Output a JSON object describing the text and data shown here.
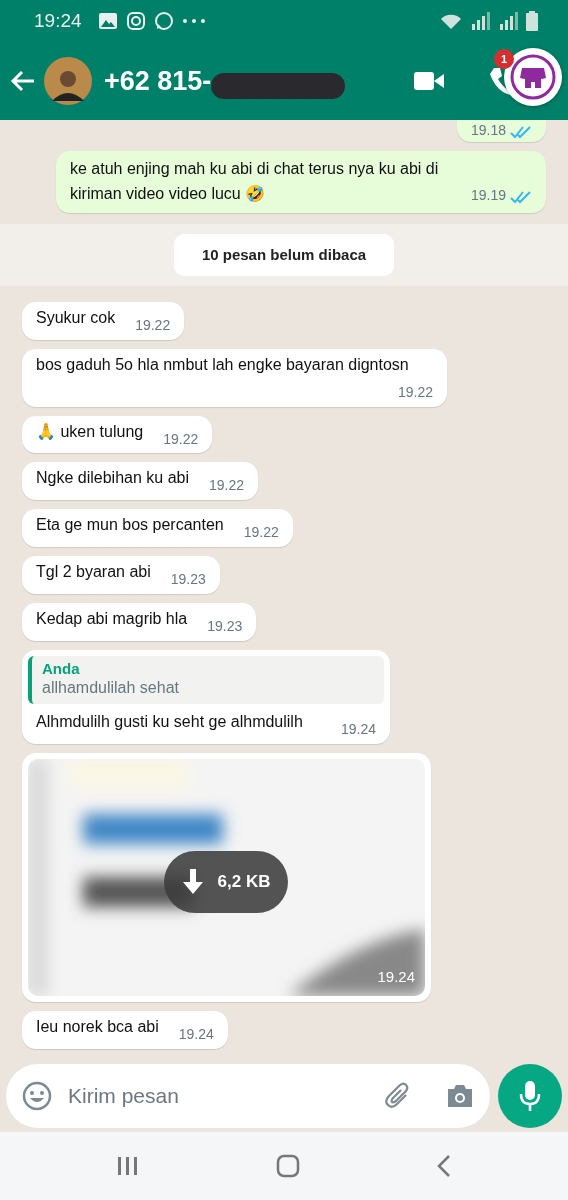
{
  "status_bar": {
    "time": "19:24"
  },
  "header": {
    "contact": "+62 815-",
    "redacted": true,
    "floating_badge": "1"
  },
  "messages": [
    {
      "kind": "out",
      "time": "19.18",
      "read": true
    },
    {
      "kind": "out",
      "text": "ke atuh enjing mah ku abi di chat terus nya ku abi di kiriman video video lucu 🤣",
      "time": "19.19",
      "read": true
    },
    {
      "kind": "divider",
      "text": "10 pesan belum dibaca"
    },
    {
      "kind": "in",
      "text": "Syukur cok",
      "time": "19.22"
    },
    {
      "kind": "in",
      "text": "bos gaduh 5o hla nmbut lah engke bayaran digntosn",
      "time": "19.22"
    },
    {
      "kind": "in",
      "text": "🙏 uken tulung",
      "time": "19.22"
    },
    {
      "kind": "in",
      "text": "Ngke dilebihan ku abi",
      "time": "19.22"
    },
    {
      "kind": "in",
      "text": "Eta ge mun bos percanten",
      "time": "19.22"
    },
    {
      "kind": "in",
      "text": "Tgl 2 byaran abi",
      "time": "19.23"
    },
    {
      "kind": "in",
      "text": "Kedap abi magrib hla",
      "time": "19.23"
    },
    {
      "kind": "quote",
      "quote_author": "Anda",
      "quote_text": "allhamdulilah sehat",
      "text": "Alhmdulilh gusti ku seht ge alhmdulilh",
      "time": "19.24"
    },
    {
      "size": "6,2 KB",
      "time": "19.24"
    },
    {
      "kind": "in",
      "text": "Ieu norek bca abi",
      "time": "19.24"
    }
  ],
  "composer": {
    "placeholder": "Kirim pesan"
  }
}
